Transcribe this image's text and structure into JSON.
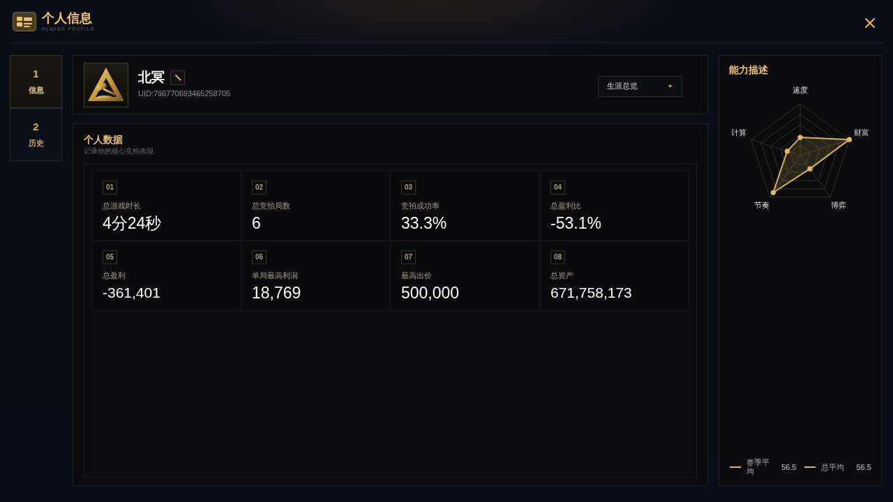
{
  "header": {
    "title": "个人信息",
    "subtitle": "PLAYER PROFILE"
  },
  "tabs": [
    {
      "number": "1",
      "label": "信息",
      "selected": true
    },
    {
      "number": "2",
      "label": "历史",
      "selected": false
    }
  ],
  "profile": {
    "name": "北冥",
    "uid": "UID:796770693465258705",
    "view_select": {
      "value": "生涯总览"
    }
  },
  "stats_panel": {
    "title": "个人数据",
    "subtitle": "记录你的核心竞拍表现",
    "stats": [
      {
        "index": "01",
        "label": "总游戏时长",
        "value": "4分24秒"
      },
      {
        "index": "02",
        "label": "总竞拍局数",
        "value": "6"
      },
      {
        "index": "03",
        "label": "竞拍成功率",
        "value": "33.3%"
      },
      {
        "index": "04",
        "label": "总盈利比",
        "value": "-53.1%"
      },
      {
        "index": "05",
        "label": "总盈利",
        "value": "-361,401"
      },
      {
        "index": "06",
        "label": "单局最高利润",
        "value": "18,769"
      },
      {
        "index": "07",
        "label": "最高出价",
        "value": "500,000"
      },
      {
        "index": "08",
        "label": "总资产",
        "value": "671,758,173"
      }
    ]
  },
  "ability_panel": {
    "title": "能力描述",
    "radar_axes": [
      "速度",
      "财富",
      "博弈",
      "节奏",
      "计算"
    ],
    "legend": [
      {
        "label": "赛季平均",
        "value": "56.5"
      },
      {
        "label": "总平均",
        "value": "56.5"
      }
    ]
  }
}
